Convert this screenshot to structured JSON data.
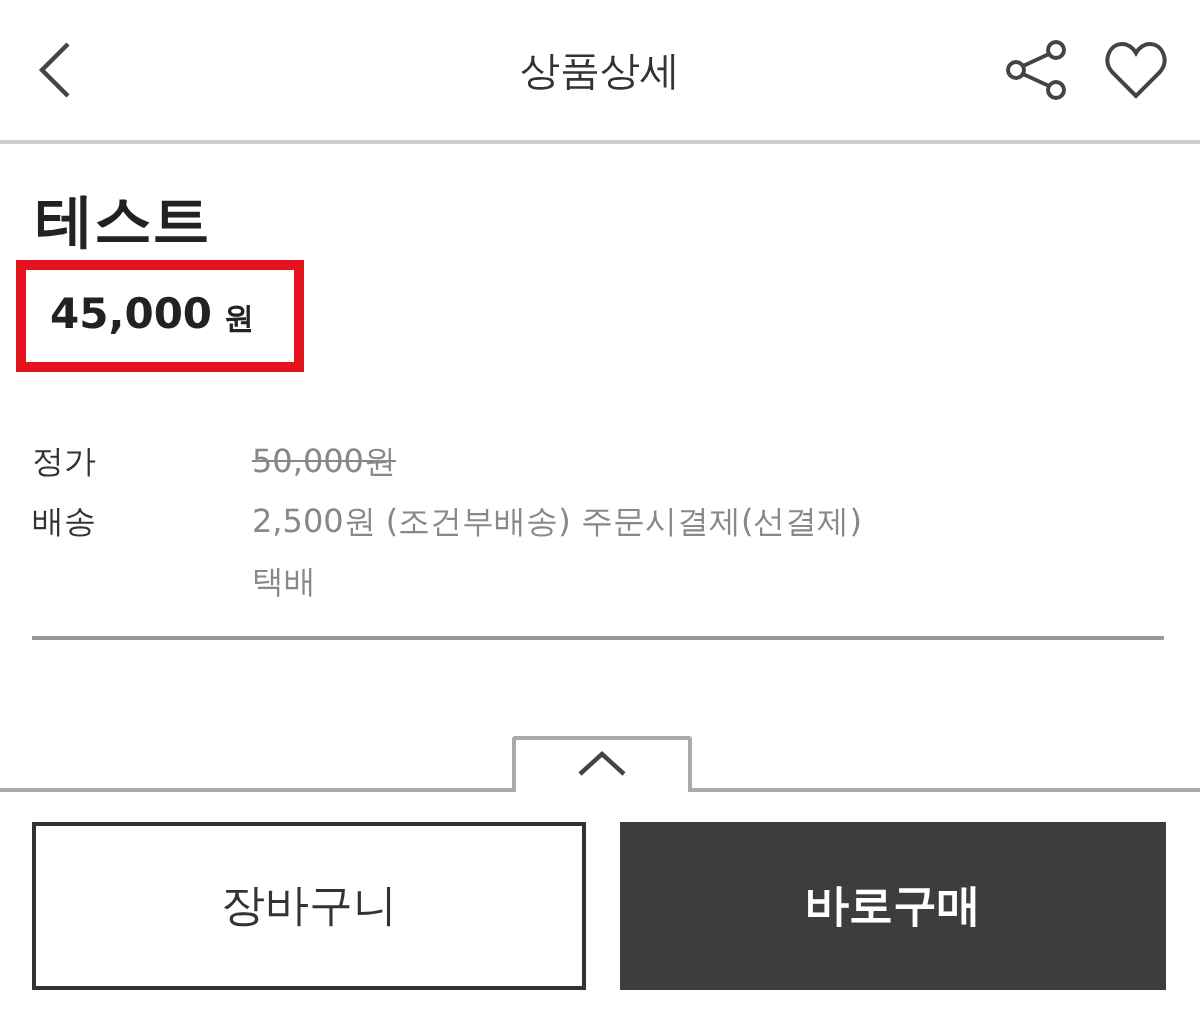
{
  "header": {
    "title": "상품상세"
  },
  "product": {
    "name": "테스트",
    "price": {
      "amount": "45,000",
      "unit": "원",
      "highlighted": true
    }
  },
  "info": [
    {
      "label": "정가",
      "lines": [
        "50,000원"
      ],
      "struck": true
    },
    {
      "label": "배송",
      "lines": [
        "2,500원 (조건부배송) 주문시결제(선결제)",
        "택배"
      ],
      "struck": false
    }
  ],
  "buttons": [
    {
      "label": "장바구니",
      "kind": "outline"
    },
    {
      "label": "바로구매",
      "kind": "filled"
    }
  ]
}
